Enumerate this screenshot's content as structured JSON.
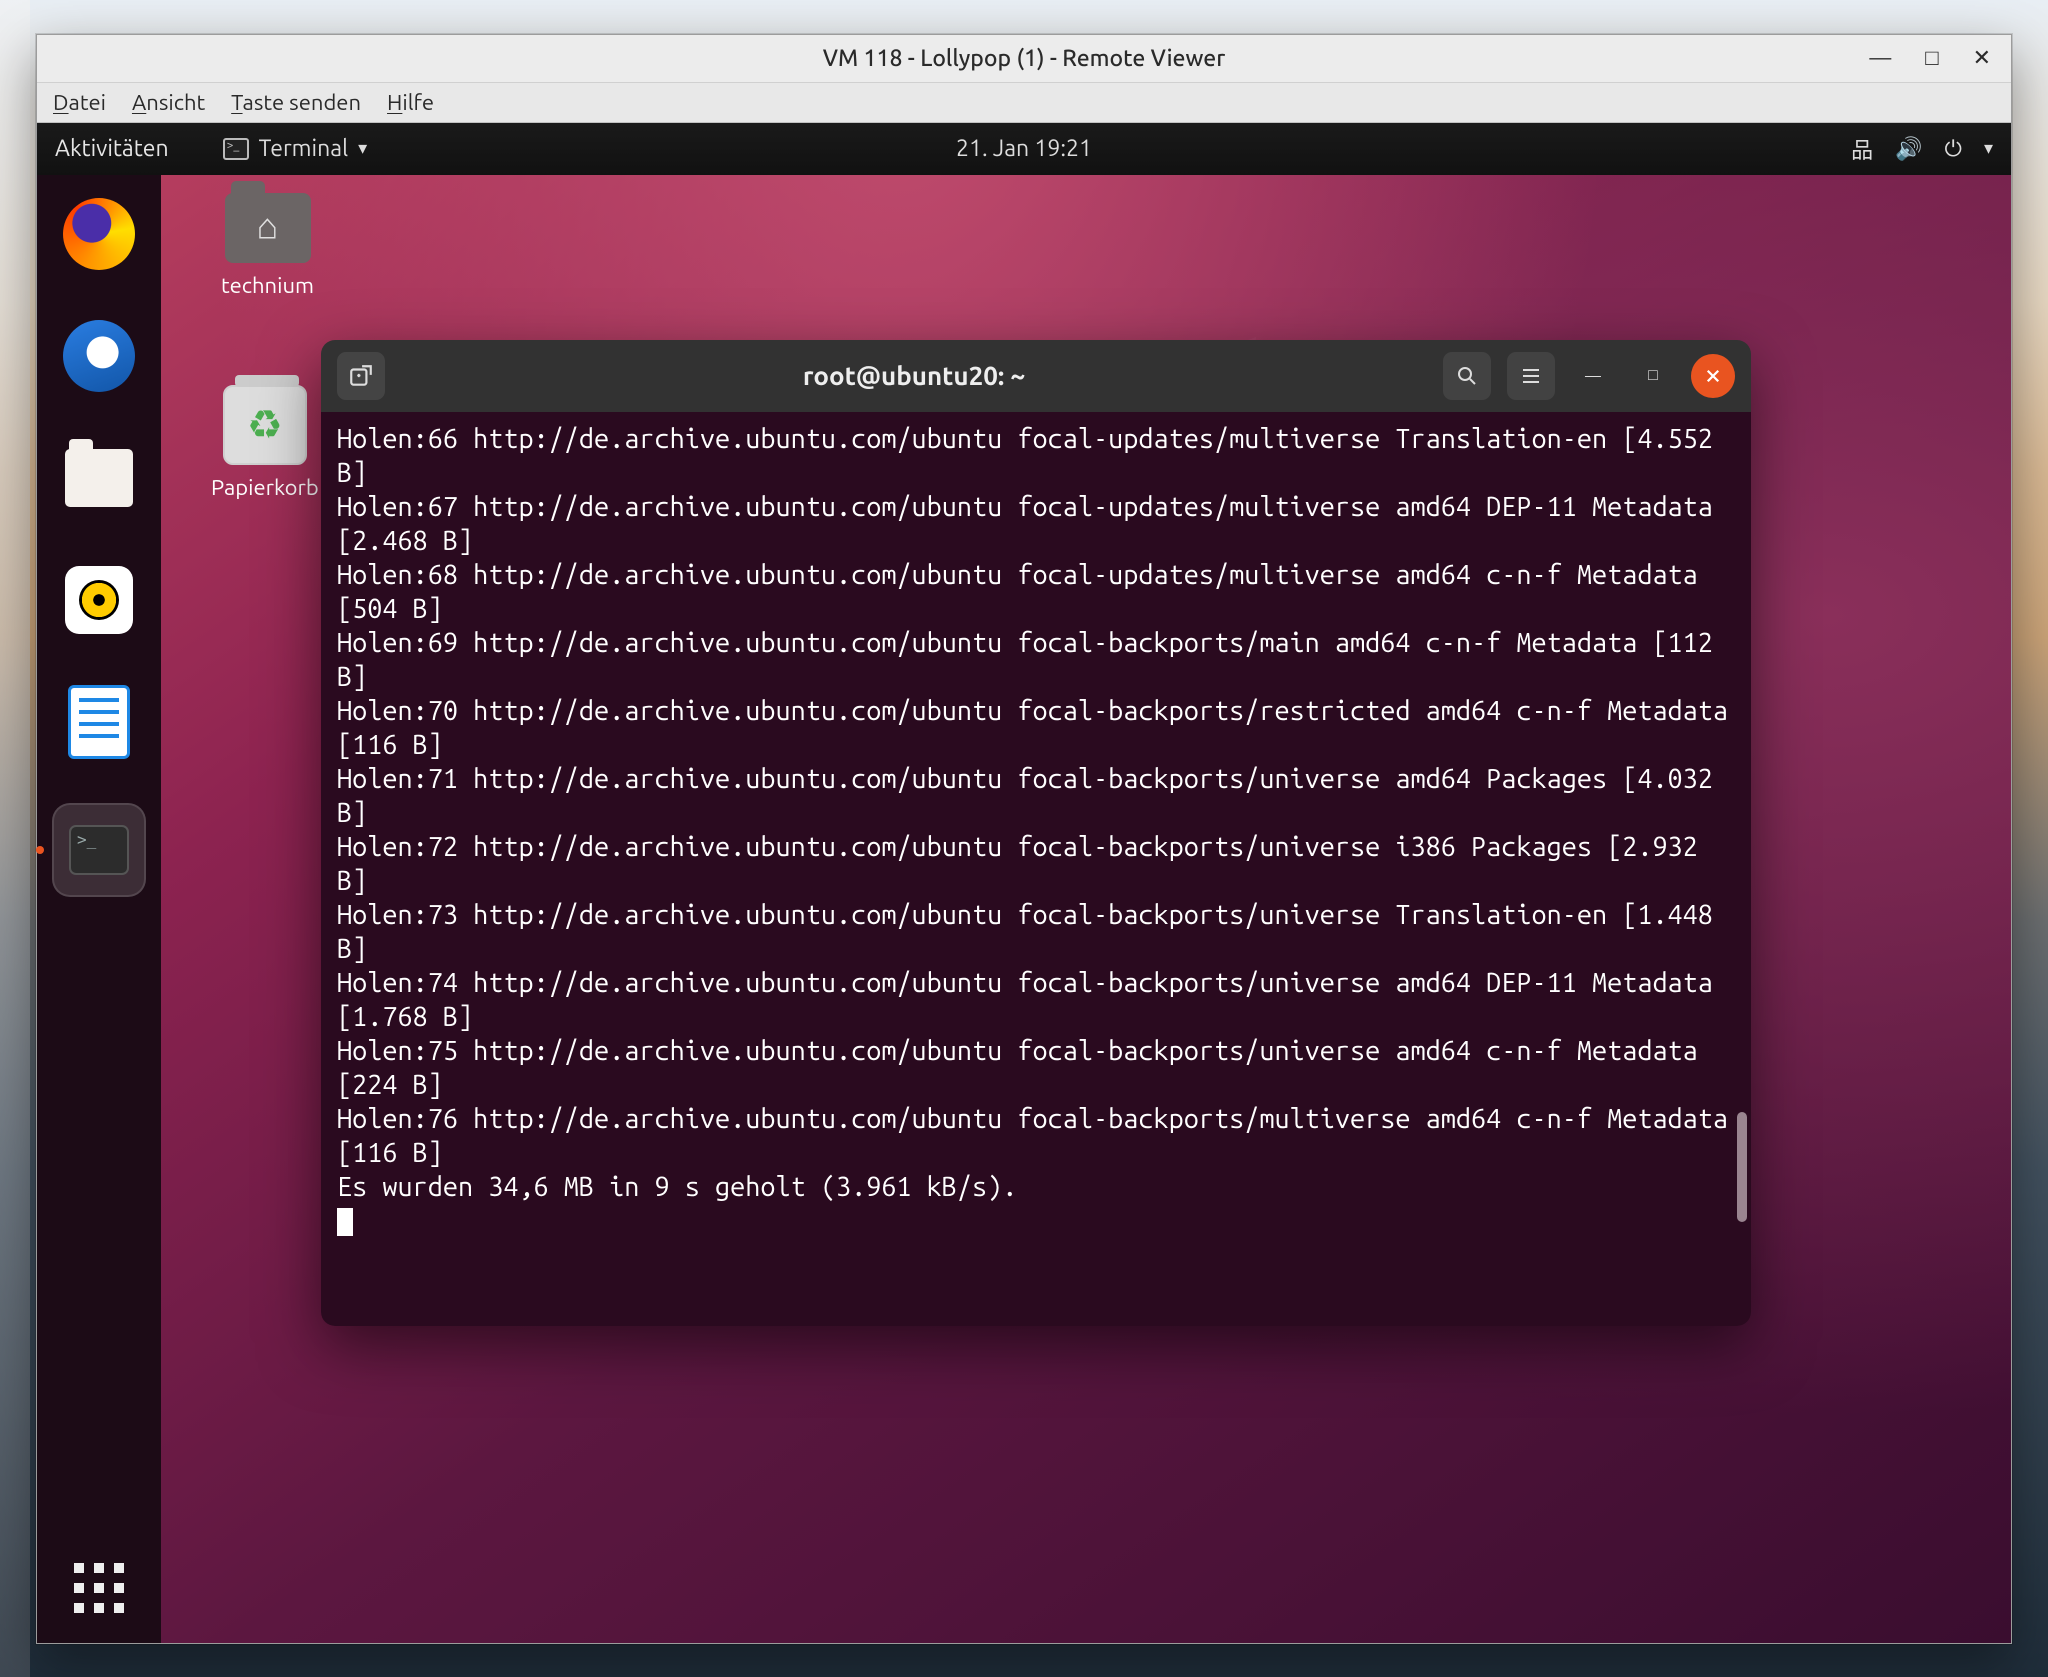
{
  "viewer": {
    "title": "VM 118 - Lollypop (1) - Remote Viewer",
    "menu": {
      "file": "Datei",
      "view": "Ansicht",
      "sendkey": "Taste senden",
      "help": "Hilfe"
    },
    "controls": {
      "min": "—",
      "max": "□",
      "close": "✕"
    }
  },
  "gnome": {
    "activities": "Aktivitäten",
    "app_label": "Terminal",
    "clock": "21. Jan  19:21",
    "dock": [
      "firefox",
      "thunderbird",
      "files",
      "rhythmbox",
      "writer",
      "terminal"
    ],
    "active_dock": "terminal"
  },
  "desktop": {
    "home_label": "technium",
    "trash_label": "Papierkorb"
  },
  "terminal": {
    "title": "root@ubuntu20: ~",
    "lines": [
      "Holen:66 http://de.archive.ubuntu.com/ubuntu focal-updates/multiverse Translation-en [4.552 B]",
      "Holen:67 http://de.archive.ubuntu.com/ubuntu focal-updates/multiverse amd64 DEP-11 Metadata [2.468 B]",
      "Holen:68 http://de.archive.ubuntu.com/ubuntu focal-updates/multiverse amd64 c-n-f Metadata [504 B]",
      "Holen:69 http://de.archive.ubuntu.com/ubuntu focal-backports/main amd64 c-n-f Metadata [112 B]",
      "Holen:70 http://de.archive.ubuntu.com/ubuntu focal-backports/restricted amd64 c-n-f Metadata [116 B]",
      "Holen:71 http://de.archive.ubuntu.com/ubuntu focal-backports/universe amd64 Packages [4.032 B]",
      "Holen:72 http://de.archive.ubuntu.com/ubuntu focal-backports/universe i386 Packages [2.932 B]",
      "Holen:73 http://de.archive.ubuntu.com/ubuntu focal-backports/universe Translation-en [1.448 B]",
      "Holen:74 http://de.archive.ubuntu.com/ubuntu focal-backports/universe amd64 DEP-11 Metadata [1.768 B]",
      "Holen:75 http://de.archive.ubuntu.com/ubuntu focal-backports/universe amd64 c-n-f Metadata [224 B]",
      "Holen:76 http://de.archive.ubuntu.com/ubuntu focal-backports/multiverse amd64 c-n-f Metadata [116 B]",
      "Es wurden 34,6 MB in 9 s geholt (3.961 kB/s)."
    ]
  }
}
